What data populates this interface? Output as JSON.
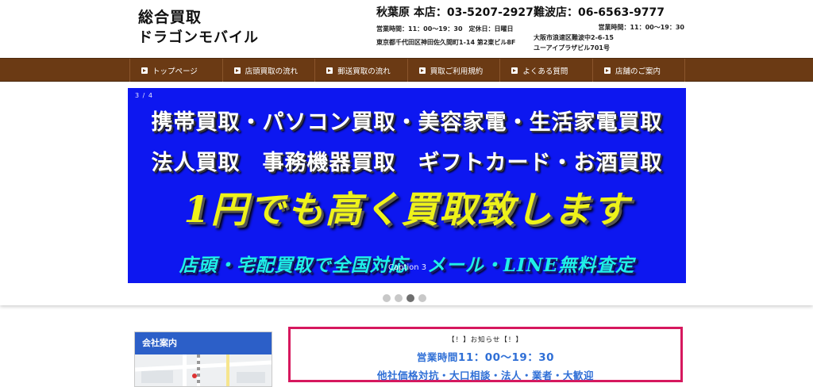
{
  "logo": {
    "line1": "総合買取",
    "line2": "ドラゴンモバイル"
  },
  "stores": {
    "main": {
      "title": "秋葉原 本店：03-5207-2927",
      "hours": "営業時間：11：00～19：30　定休日：日曜日",
      "address": "東京都千代田区神田佐久間町1-14 第2東ビル8F"
    },
    "namba": {
      "title": "難波店：06-6563-9777",
      "hours": "営業時間：11：00～19：30",
      "address1": "大阪市浪速区難波中2-6-15",
      "address2": "ユーアイプラザビル701号"
    }
  },
  "nav": {
    "items": [
      {
        "label": "トップページ"
      },
      {
        "label": "店頭買取の流れ"
      },
      {
        "label": "郵送買取の流れ"
      },
      {
        "label": "買取ご利用規約"
      },
      {
        "label": "よくある質問"
      },
      {
        "label": "店舗のご案内"
      }
    ]
  },
  "slider": {
    "counter": "3 / 4",
    "line1": "携帯買取・パソコン買取・美容家電・生活家電買取",
    "line2": "法人買取　事務機器買取　ギフトカード・お酒買取",
    "line3": "1円でも高く買取致します",
    "line4": "店頭・宅配買取で全国対応　メール・LINE無料査定",
    "caption": "Caption 3",
    "dots_total": 4,
    "active_dot": 3,
    "colors": {
      "background": "#0d17f0",
      "headline": "#eef21a",
      "subline": "#1ff0e8"
    }
  },
  "sidebar": {
    "title": "会社案内"
  },
  "notice": {
    "title": "【！】お知らせ【！】",
    "hours_label": "営業時間",
    "hours_value": "11：00～19：30",
    "offer": "他社価格対抗・大口相談・法人・業者・大歓迎"
  },
  "colors": {
    "nav_bg": "#6b3a14",
    "notice_border": "#d6185e",
    "notice_text": "#2f6fd6",
    "sidebar_head": "#2c5fc8"
  }
}
